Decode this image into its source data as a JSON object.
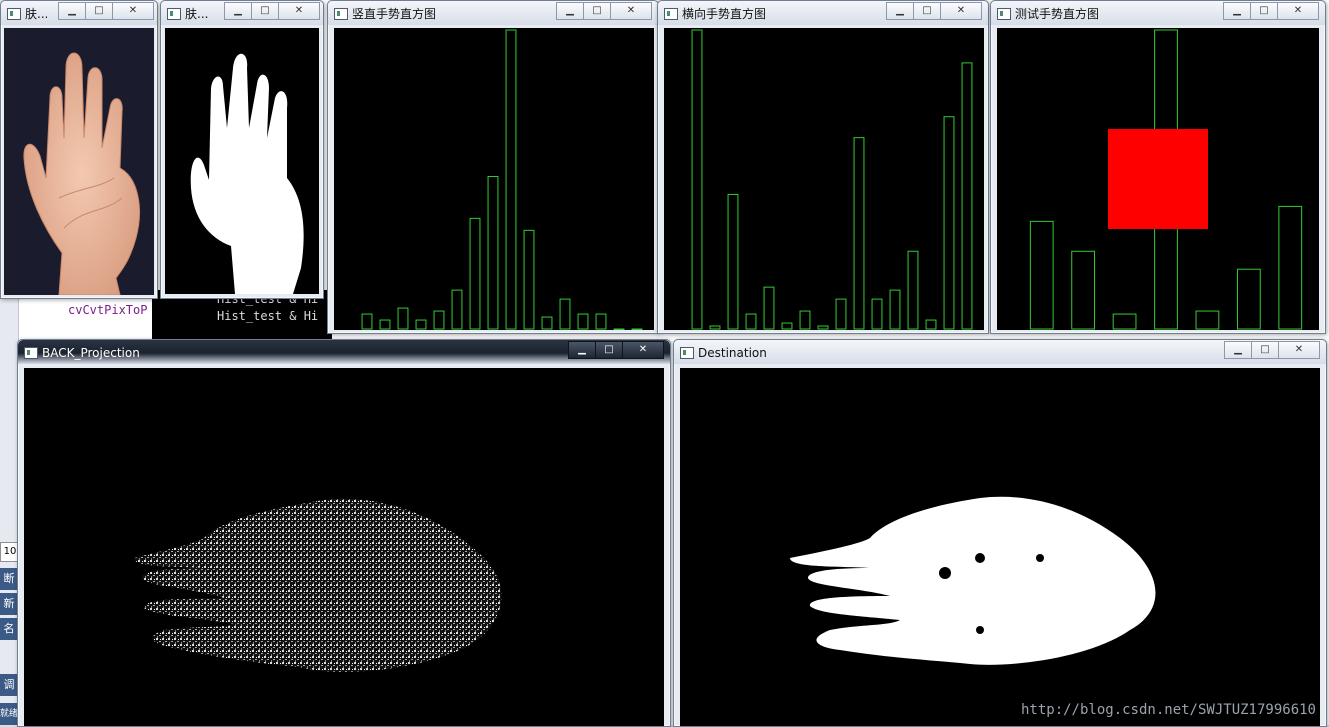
{
  "ide": {
    "code_lines": [
      "cvCvtPixToP",
      "Hist_test & Hi",
      "Hist_test & Hi"
    ],
    "side_tabs": [
      "断",
      "新",
      "名",
      "调",
      "就绪"
    ],
    "line_box": "10"
  },
  "windows": [
    {
      "id": "skin1",
      "title": "肤...",
      "icon": "window-app-icon"
    },
    {
      "id": "skin2",
      "title": "肤...",
      "icon": "window-app-icon"
    },
    {
      "id": "vhist",
      "title": "竖直手势直方图",
      "icon": "window-app-icon"
    },
    {
      "id": "hhist",
      "title": "横向手势直方图",
      "icon": "window-app-icon"
    },
    {
      "id": "thist",
      "title": "测试手势直方图",
      "icon": "window-app-icon"
    },
    {
      "id": "back",
      "title": "BACK_Projection",
      "icon": "window-app-icon"
    },
    {
      "id": "dest",
      "title": "Destination",
      "icon": "window-app-icon"
    }
  ],
  "controls": {
    "minimize": "▁",
    "maximize": "□",
    "close": "✕"
  },
  "watermark": "http://blog.csdn.net/SWJTUZ17996610",
  "colors": {
    "bar": "#33cc33",
    "marker": "#ff0000",
    "image_bg": "#000000",
    "mask": "#ffffff"
  },
  "chart_data": [
    {
      "type": "bar",
      "window": "竖直手势直方图",
      "values": [
        5,
        3,
        7,
        3,
        6,
        13,
        37,
        51,
        100,
        33,
        4,
        10,
        5,
        5,
        0,
        0
      ]
    },
    {
      "type": "bar",
      "window": "横向手势直方图",
      "values": [
        100,
        1,
        45,
        5,
        14,
        2,
        6,
        1,
        10,
        64,
        10,
        13,
        26,
        3,
        71,
        89
      ]
    },
    {
      "type": "bar",
      "window": "测试手势直方图",
      "values": [
        36,
        26,
        5,
        100,
        6,
        20,
        41
      ],
      "marker": {
        "type": "square",
        "color": "#ff0000"
      }
    }
  ]
}
